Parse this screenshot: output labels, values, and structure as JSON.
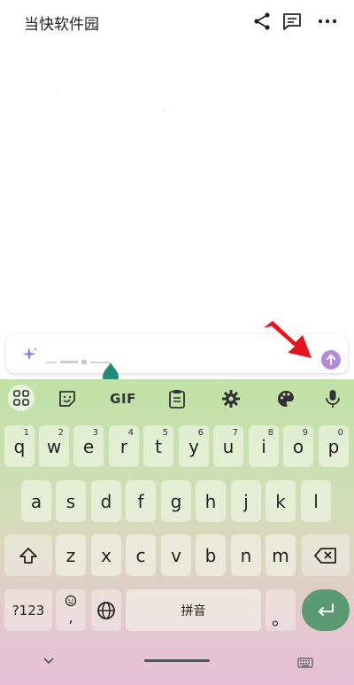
{
  "header": {
    "title": "当快软件园",
    "icons": [
      "share-icon",
      "comment-icon",
      "more-icon"
    ]
  },
  "input": {
    "placeholder": "",
    "value": ""
  },
  "toolbar": {
    "gif_label": "GIF",
    "icons": [
      "apps-grid-icon",
      "sticker-icon",
      "clipboard-icon",
      "settings-gear-icon",
      "palette-icon",
      "microphone-icon"
    ]
  },
  "keyboard": {
    "row1": [
      {
        "label": "q",
        "hint": "1"
      },
      {
        "label": "w",
        "hint": "2"
      },
      {
        "label": "e",
        "hint": "3"
      },
      {
        "label": "r",
        "hint": "4"
      },
      {
        "label": "t",
        "hint": "5"
      },
      {
        "label": "y",
        "hint": "6"
      },
      {
        "label": "u",
        "hint": "7"
      },
      {
        "label": "i",
        "hint": "8"
      },
      {
        "label": "o",
        "hint": "9"
      },
      {
        "label": "p",
        "hint": "0"
      }
    ],
    "row2": [
      "a",
      "s",
      "d",
      "f",
      "g",
      "h",
      "j",
      "k",
      "l"
    ],
    "row3": [
      "z",
      "x",
      "c",
      "v",
      "b",
      "n",
      "m"
    ],
    "symbols_label": "?123",
    "comma_label": ",",
    "space_label": "拼音",
    "period_label": "。"
  },
  "colors": {
    "keyboard_top": "#bfe2a6",
    "keyboard_bottom": "#e6bfd6",
    "enter_key": "#5a9a73",
    "send_button": "#b58ad6",
    "cursor_drop": "#1f8a7a",
    "red_arrow": "#e8141b"
  }
}
